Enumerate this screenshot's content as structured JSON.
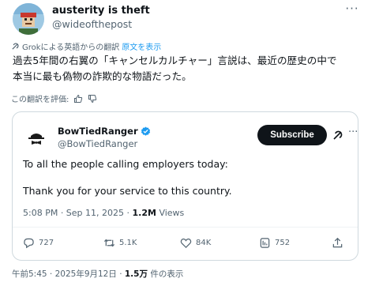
{
  "tweet": {
    "author_name": "austerity is theft",
    "author_handle": "@wideofthepost",
    "more_label": "···",
    "translation_note": "Grokによる英語からの翻訳",
    "show_original": "原文を表示",
    "text_line1": "過去5年間の右翼の「キャンセルカルチャー」言説は、最近の歴史の中で",
    "text_line2": "本当に最も偽物の詐欺的な物語だった。",
    "rate_label": "この翻訳を評価:",
    "timestamp": "午前5:45 · 2025年9月12日 · ",
    "views_count": "1.5万",
    "views_suffix": " 件の表示"
  },
  "quoted": {
    "author_name": "BowTiedRanger",
    "author_handle": "@BowTiedRanger",
    "subscribe_label": "Subscribe",
    "line1": "To all the people calling employers today:",
    "line2": "Thank you for your service to this country.",
    "time": "5:08 PM · Sep 11, 2025 · ",
    "views_count": "1.2M",
    "views_label": " Views",
    "actions": {
      "replies": "727",
      "reposts": "5.1K",
      "likes": "84K",
      "bookmarks": "752"
    }
  },
  "colors": {
    "accent": "#1d9bf0",
    "muted": "#536471",
    "verified": "#1d9bf0"
  },
  "icons": [
    "grok-icon",
    "thumbs-up-icon",
    "thumbs-down-icon",
    "verified-badge-icon",
    "reply-icon",
    "repost-icon",
    "like-icon",
    "views-icon",
    "share-icon"
  ]
}
